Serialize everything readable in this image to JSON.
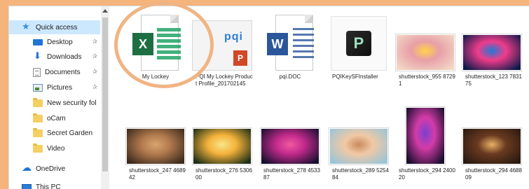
{
  "accent": "#f0b483",
  "nav": {
    "items": [
      {
        "label": "Quick access",
        "icon": "star-icon",
        "selected": true
      },
      {
        "label": "Desktop",
        "icon": "desktop-icon",
        "pinned": true
      },
      {
        "label": "Downloads",
        "icon": "download-icon",
        "pinned": true
      },
      {
        "label": "Documents",
        "icon": "documents-icon",
        "pinned": true
      },
      {
        "label": "Pictures",
        "icon": "pictures-icon",
        "pinned": true
      },
      {
        "label": "New security fol",
        "icon": "folder-icon"
      },
      {
        "label": "oCam",
        "icon": "folder-icon"
      },
      {
        "label": "Secret Garden",
        "icon": "folder-icon"
      },
      {
        "label": "Video",
        "icon": "folder-icon"
      },
      {
        "label": "OneDrive",
        "icon": "cloud-icon"
      },
      {
        "label": "This PC",
        "icon": "computer-icon"
      }
    ],
    "pin_glyph": "✰"
  },
  "files": {
    "row1": [
      {
        "name": "My Lockey",
        "type": "excel",
        "badge": "X"
      },
      {
        "name": "PQI My Lockey Product Profile_201702145",
        "type": "powerpoint-thumb",
        "brand": "pqi",
        "badge": "P"
      },
      {
        "name": "pqi.DOC",
        "type": "word",
        "badge": "W"
      },
      {
        "name": "PQIKeySFInstaller",
        "type": "installer"
      },
      {
        "name": "shutterstock_955 87291",
        "type": "photo",
        "colors": [
          "#f2d7c4",
          "#e89fa8",
          "#ffd24a"
        ]
      },
      {
        "name": "shutterstock_123 783175",
        "type": "photo",
        "colors": [
          "#0c1a4a",
          "#ef3c8a",
          "#1f79d6"
        ]
      }
    ],
    "row2": [
      {
        "name": "shutterstock_247 468942",
        "type": "photo",
        "colors": [
          "#3c2a1c",
          "#b37b4e",
          "#d8a46f"
        ]
      },
      {
        "name": "shutterstock_276 530600",
        "type": "photo",
        "colors": [
          "#1c2e16",
          "#f4b23a",
          "#f7e58a"
        ]
      },
      {
        "name": "shutterstock_278 453387",
        "type": "photo",
        "colors": [
          "#150f2e",
          "#c32a8c",
          "#f05aa0"
        ]
      },
      {
        "name": "shutterstock_289 525484",
        "type": "photo",
        "colors": [
          "#9ac4d8",
          "#f1c9a4",
          "#c98a5f"
        ]
      },
      {
        "name": "shutterstock_294 240020",
        "type": "photo-tall",
        "colors": [
          "#150c2a",
          "#d33ca8",
          "#7a3fd0"
        ]
      },
      {
        "name": "shutterstock_294 468809",
        "type": "photo",
        "colors": [
          "#2a1a10",
          "#6a3a20",
          "#e9b065"
        ]
      }
    ]
  }
}
